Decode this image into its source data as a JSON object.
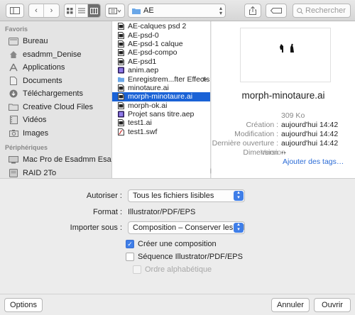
{
  "toolbar": {
    "path": "AE",
    "search_placeholder": "Rechercher",
    "icons": [
      "sidebar-toggle-icon",
      "back-icon",
      "forward-icon",
      "icon-view-icon",
      "list-view-icon",
      "column-view-icon",
      "gallery-view-icon",
      "folder-icon",
      "share-icon",
      "tag-icon",
      "search-icon"
    ]
  },
  "sidebar": {
    "favorites_header": "Favoris",
    "favorites": [
      {
        "label": "Bureau",
        "icon": "desktop-icon"
      },
      {
        "label": "esadmm_Denise",
        "icon": "home-icon"
      },
      {
        "label": "Applications",
        "icon": "applications-icon"
      },
      {
        "label": "Documents",
        "icon": "documents-icon"
      },
      {
        "label": "Téléchargements",
        "icon": "downloads-icon"
      },
      {
        "label": "Creative Cloud Files",
        "icon": "folder-icon"
      },
      {
        "label": "Vidéos",
        "icon": "movies-icon"
      },
      {
        "label": "Images",
        "icon": "pictures-icon"
      }
    ],
    "devices_header": "Périphériques",
    "devices": [
      {
        "label": "Mac Pro de Esadmm Esa...",
        "icon": "computer-icon"
      },
      {
        "label": "RAID 2To",
        "icon": "drive-icon"
      }
    ]
  },
  "files": [
    {
      "name": "AE-calques psd 2",
      "type": "ai"
    },
    {
      "name": "AE-psd-0",
      "type": "ai"
    },
    {
      "name": "AE-psd-1 calque",
      "type": "ai"
    },
    {
      "name": "AE-psd-compo",
      "type": "ai"
    },
    {
      "name": "AE-psd1",
      "type": "ai"
    },
    {
      "name": "anim.aep",
      "type": "aep"
    },
    {
      "name": "Enregistrem...fter Effects",
      "type": "folder"
    },
    {
      "name": "minotaure.ai",
      "type": "ai"
    },
    {
      "name": "morph-minotaure.ai",
      "type": "ai"
    },
    {
      "name": "morph-ok.ai",
      "type": "ai"
    },
    {
      "name": "Projet sans titre.aep",
      "type": "aep"
    },
    {
      "name": "test1.ai",
      "type": "ai"
    },
    {
      "name": "test1.swf",
      "type": "swf"
    }
  ],
  "preview": {
    "filename": "morph-minotaure.ai",
    "size": "309 Ko",
    "rows": [
      {
        "key": "Création :",
        "value": "aujourd'hui 14:42"
      },
      {
        "key": "Modification :",
        "value": "aujourd'hui 14:42"
      },
      {
        "key": "Dernière ouverture :",
        "value": "aujourd'hui 14:42"
      },
      {
        "key": "Dimension",
        "overlap": "Version",
        "value": "--"
      }
    ],
    "tags_link": "Ajouter des tags…"
  },
  "options": {
    "autoriser_label": "Autoriser :",
    "autoriser_value": "Tous les fichiers lisibles",
    "format_label": "Format :",
    "format_value": "Illustrator/PDF/EPS",
    "importer_label": "Importer sous :",
    "importer_value": "Composition – Conserver les taill...",
    "cb_creer": "Créer une composition",
    "cb_sequence": "Séquence Illustrator/PDF/EPS",
    "cb_alpha": "Ordre alphabétique"
  },
  "buttons": {
    "options": "Options",
    "annuler": "Annuler",
    "ouvrir": "Ouvrir"
  }
}
